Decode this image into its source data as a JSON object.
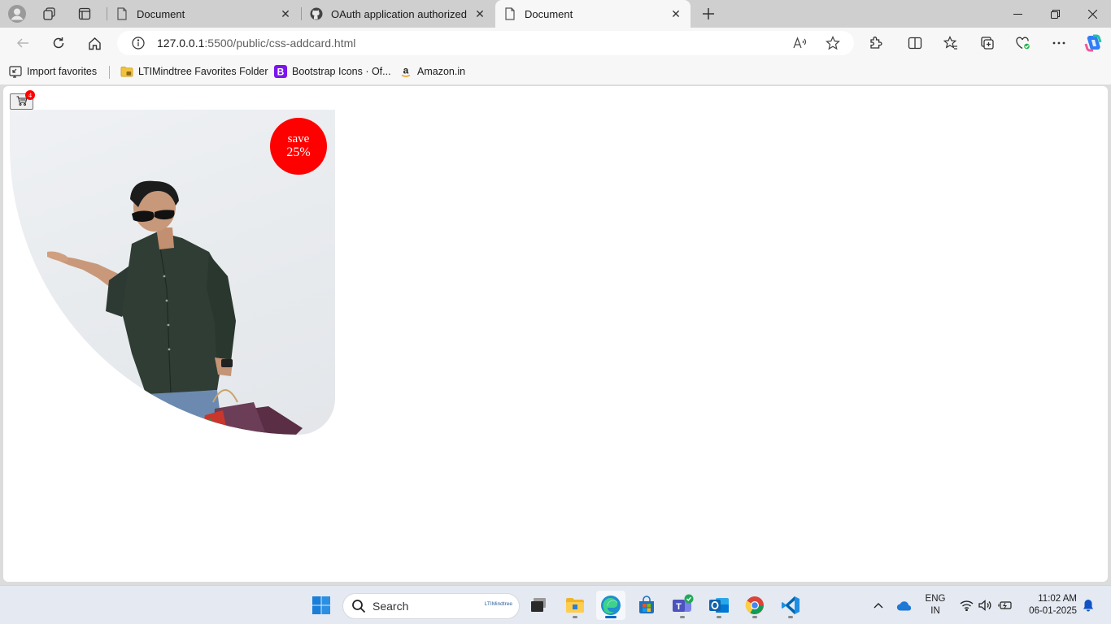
{
  "browser": {
    "tabs": [
      {
        "title": "Document",
        "favicon": "page-icon",
        "active": false
      },
      {
        "title": "OAuth application authorized",
        "favicon": "github-icon",
        "active": false
      },
      {
        "title": "Document",
        "favicon": "page-icon",
        "active": true
      }
    ],
    "address_bar": {
      "host": "127.0.0.1",
      "path": ":5500/public/css-addcard.html"
    },
    "favorites": [
      {
        "label": "Import favorites",
        "icon": "import-icon"
      },
      {
        "label": "LTIMindtree Favorites Folder",
        "icon": "folder-icon"
      },
      {
        "label": "Bootstrap Icons · Of...",
        "icon": "bootstrap-icon"
      },
      {
        "label": "Amazon.in",
        "icon": "amazon-icon"
      }
    ]
  },
  "page": {
    "cart_count": "4",
    "card": {
      "badge_line1": "save",
      "badge_line2": "25%",
      "image": "man-with-shopping-bags"
    },
    "colors": {
      "badge": "#ff0000",
      "image_bg": "#e8ebee"
    }
  },
  "taskbar": {
    "search_placeholder": "Search",
    "search_brand": "LTIMindtree",
    "language_line1": "ENG",
    "language_line2": "IN",
    "time": "11:02 AM",
    "date": "06-01-2025"
  }
}
